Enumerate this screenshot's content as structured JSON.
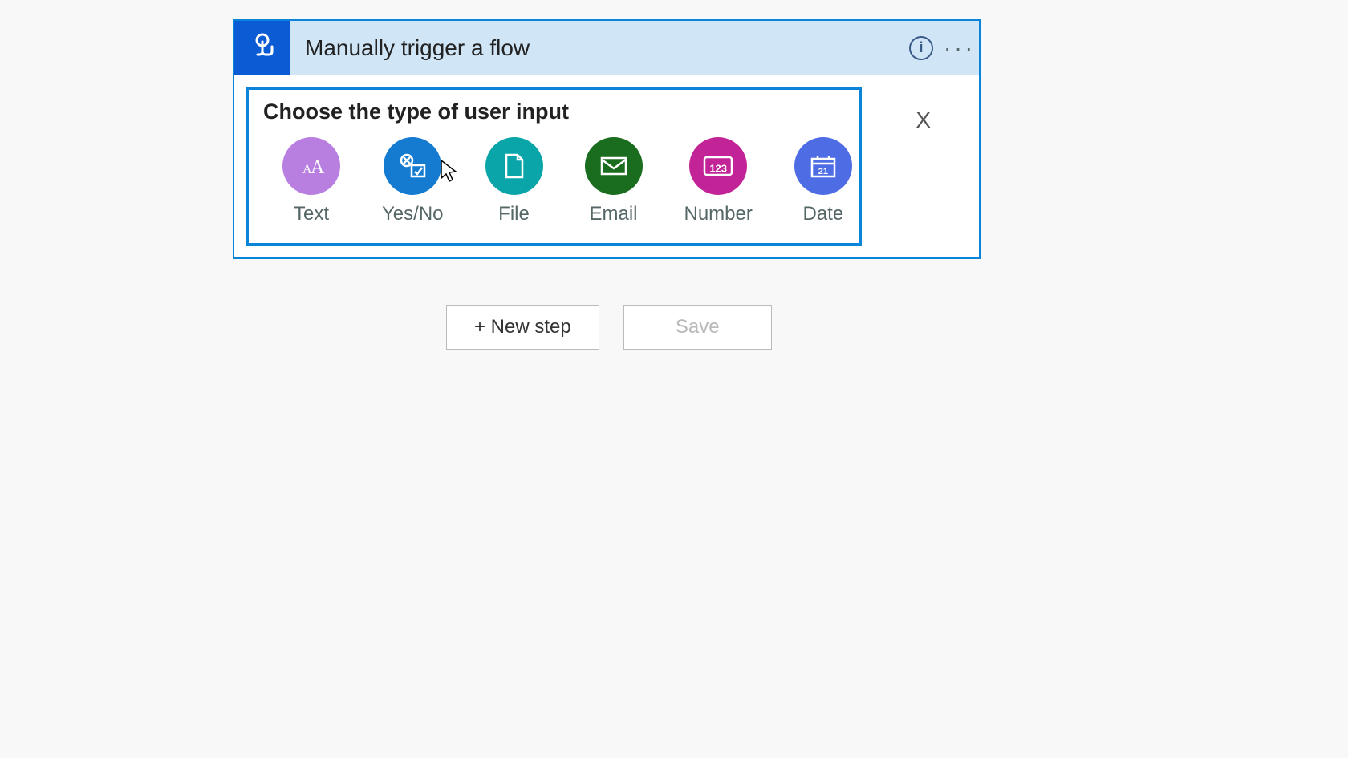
{
  "trigger": {
    "title": "Manually trigger a flow"
  },
  "panel": {
    "title": "Choose the type of user input",
    "close_label": "X"
  },
  "options": [
    {
      "label": "Text"
    },
    {
      "label": "Yes/No"
    },
    {
      "label": "File"
    },
    {
      "label": "Email"
    },
    {
      "label": "Number"
    },
    {
      "label": "Date",
      "day": "21"
    }
  ],
  "actions": {
    "new_step": "+ New step",
    "save": "Save"
  },
  "info_icon_glyph": "i",
  "more_icon_glyph": "···",
  "number_icon_text": "123"
}
